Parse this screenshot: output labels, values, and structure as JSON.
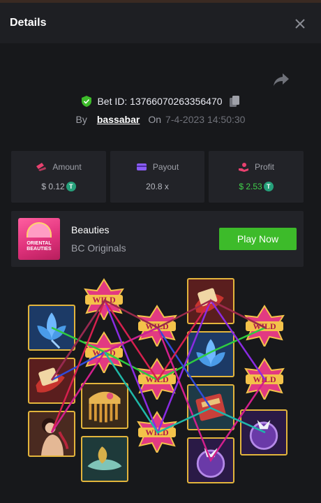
{
  "header": {
    "title": "Details"
  },
  "bet": {
    "id_label": "Bet ID: 13766070263356470",
    "by_label": "By",
    "username": "bassabar",
    "on_label": "On",
    "datetime": "7-4-2023 14:50:30"
  },
  "stats": {
    "amount": {
      "label": "Amount",
      "value": "$ 0.12"
    },
    "payout": {
      "label": "Payout",
      "value": "20.8 x"
    },
    "profit": {
      "label": "Profit",
      "value": "$ 2.53"
    }
  },
  "currency_icon": "tether-coin-icon",
  "game": {
    "name": "Beauties",
    "provider": "BC Originals",
    "thumb_line1": "ORIENTAL",
    "thumb_line2": "BEAUTIES",
    "play_label": "Play Now"
  },
  "reels": {
    "wild_text": "WILD",
    "symbols": [
      "blue-lotus",
      "wild",
      "red-scroll",
      "wild",
      "woman",
      "wild",
      "blue-lotus",
      "comb",
      "lotus-hat",
      "wild",
      "red-book",
      "wild",
      "purple-mirror",
      "wild",
      "purple-mirror",
      "purple-mirror"
    ]
  },
  "colors": {
    "accent_green": "#3dbb2a",
    "profit_green": "#3fd14a",
    "frame_gold": "#e3b53c",
    "background": "#17181b",
    "card": "#222328"
  }
}
